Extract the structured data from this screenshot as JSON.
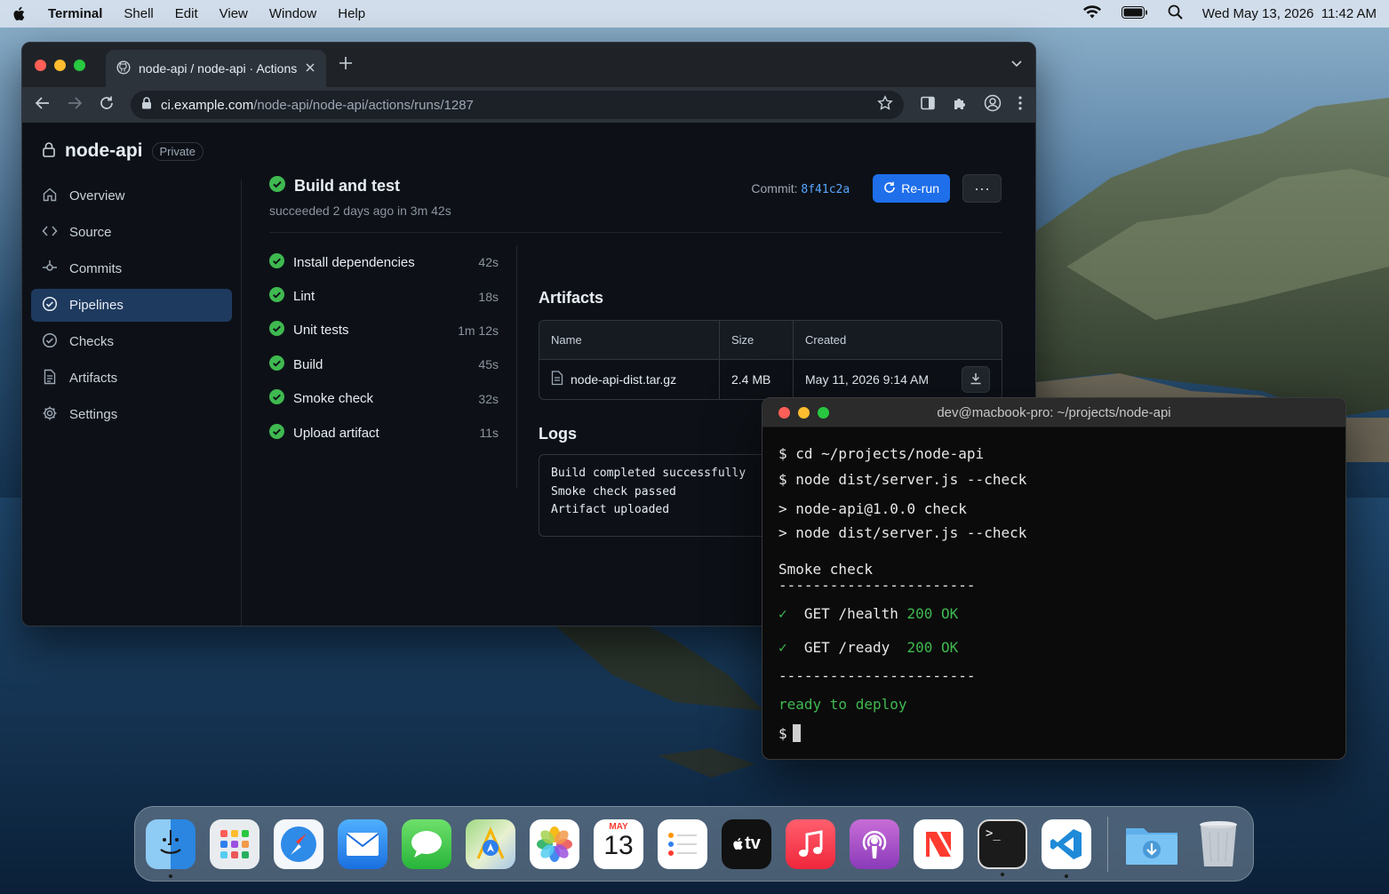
{
  "menubar": {
    "app_name": "Terminal",
    "menus": [
      "Shell",
      "Edit",
      "View",
      "Window",
      "Help"
    ],
    "datetime": "Wed May 13, 2026  11:42 AM"
  },
  "browser": {
    "tab_title": "node-api / node-api · Actions",
    "url_host": "ci.example.com",
    "url_path": "/node-api/node-api/actions/runs/1287",
    "repo": {
      "name": "node-api",
      "visibility": "Private"
    },
    "sidebar": [
      {
        "label": "Overview",
        "icon": "home-icon"
      },
      {
        "label": "Source",
        "icon": "code-icon"
      },
      {
        "label": "Commits",
        "icon": "commit-icon"
      },
      {
        "label": "Pipelines",
        "icon": "check-circle-icon",
        "active": true
      },
      {
        "label": "Checks",
        "icon": "check-circle-icon"
      },
      {
        "label": "Artifacts",
        "icon": "file-icon"
      },
      {
        "label": "Settings",
        "icon": "gear-icon"
      }
    ],
    "run": {
      "title": "Build and test",
      "subtitle": "succeeded 2 days ago in 3m 42s",
      "commit_label": "Commit:",
      "commit_sha": "8f41c2a",
      "rerun_label": "Re-run",
      "more_label": "···"
    },
    "steps": [
      {
        "name": "Install dependencies",
        "duration": "42s"
      },
      {
        "name": "Lint",
        "duration": "18s"
      },
      {
        "name": "Unit tests",
        "duration": "1m 12s"
      },
      {
        "name": "Build",
        "duration": "45s"
      },
      {
        "name": "Smoke check",
        "duration": "32s"
      },
      {
        "name": "Upload artifact",
        "duration": "11s"
      }
    ],
    "artifacts": {
      "title": "Artifacts",
      "columns": [
        "Name",
        "Size",
        "Created"
      ],
      "rows": [
        {
          "name": "node-api-dist.tar.gz",
          "size": "2.4 MB",
          "created": "May 11, 2026 9:14 AM"
        }
      ]
    },
    "logs": {
      "title": "Logs",
      "lines": [
        "Build completed successfully",
        "Smoke check passed",
        "Artifact uploaded"
      ]
    }
  },
  "terminal": {
    "title": "dev@macbook-pro: ~/projects/node-api",
    "lines": [
      "$ cd ~/projects/node-api",
      "$ node dist/server.js --check",
      "> node-api@1.0.0 check",
      "> node dist/server.js --check",
      "Smoke check",
      "-----------------------",
      "-----------------------",
      "ready to deploy",
      "$"
    ],
    "checks": [
      {
        "mark": "✓",
        "request": "GET /health",
        "status": "200 OK"
      },
      {
        "mark": "✓",
        "request": "GET /ready ",
        "status": "200 OK"
      }
    ]
  },
  "dock": {
    "calendar_month": "MAY",
    "calendar_day": "13",
    "tv_label": "tv",
    "terminal_glyph": ">_"
  },
  "colors": {
    "accent": "#1f6feb",
    "success": "#3fb950",
    "link": "#58a6ff",
    "sidebar_active": "#1f3a5f"
  }
}
